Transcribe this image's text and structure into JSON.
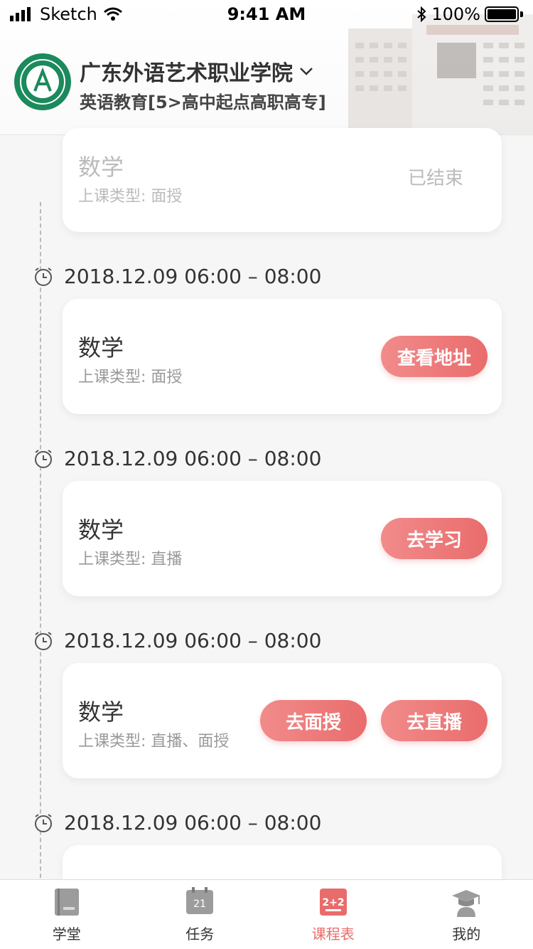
{
  "status_bar": {
    "carrier": "Sketch",
    "time": "9:41 AM",
    "battery": "100%"
  },
  "header": {
    "school_name": "广东外语艺术职业学院",
    "major": "英语教育[5>高中起点高职高专]"
  },
  "schedule": [
    {
      "time": "",
      "title": "数学",
      "type_label": "上课类型: 面授",
      "status": "已结束"
    },
    {
      "time": "2018.12.09 06:00 – 08:00",
      "title": "数学",
      "type_label": "上课类型: 面授",
      "buttons": [
        "查看地址"
      ]
    },
    {
      "time": "2018.12.09 06:00 – 08:00",
      "title": "数学",
      "type_label": "上课类型: 直播",
      "buttons": [
        "去学习"
      ]
    },
    {
      "time": "2018.12.09 06:00 – 08:00",
      "title": "数学",
      "type_label": "上课类型: 直播、面授",
      "buttons": [
        "去面授",
        "去直播"
      ]
    },
    {
      "time": "2018.12.09 06:00 – 08:00"
    }
  ],
  "tabs": [
    {
      "label": "学堂",
      "icon": "book-icon",
      "active": false
    },
    {
      "label": "任务",
      "icon": "calendar-icon",
      "active": false
    },
    {
      "label": "课程表",
      "icon": "schedule-icon",
      "active": true
    },
    {
      "label": "我的",
      "icon": "graduate-icon",
      "active": false
    }
  ],
  "colors": {
    "accent": "#e96c6c",
    "logo_green": "#1b8a5c"
  }
}
